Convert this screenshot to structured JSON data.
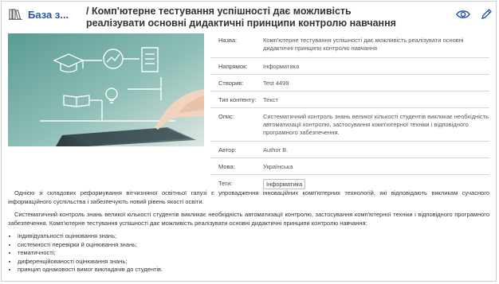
{
  "header": {
    "breadcrumb": "База з...",
    "title": "/ Комп'ютерне тестування успішності дає можливість реалізувати основні дидактичні принципи контролю навчання",
    "icons": {
      "library": "books-icon",
      "view": "eye-icon",
      "edit": "pencil-icon"
    },
    "accent_color": "#2a55a5"
  },
  "info": {
    "rows": [
      {
        "key": "Назва:",
        "value": "Комп'ютерне тестування успішності дає можливість реалізувати основні дидактичні принципи контролю навчання"
      },
      {
        "key": "Напрямок:",
        "value": "Інформатика"
      },
      {
        "key": "Створив:",
        "value": "Test 4499"
      },
      {
        "key": "Тип контенту:",
        "value": "Текст"
      },
      {
        "key": "Опис:",
        "value": "Систематичний контроль знань великої кількості студентів викликає необхідність автоматизації контролю, застосування комп'ютерної техніки і відповідного програмного забезпечення."
      },
      {
        "key": "Автор:",
        "value": "Author B."
      },
      {
        "key": "Мова:",
        "value": "Українська"
      },
      {
        "key": "Теги:",
        "tag": "Інформатика"
      }
    ]
  },
  "description": {
    "paragraphs": [
      "Однією зі складових реформування вітчизняної освітньої галузі є упровадження інноваційних комп'ютерних технологій, які відповідають викликам сучасного інформаційного суспільства і забезпечують новий рівень якості освіти.",
      "Систематичний контроль знань великої кількості студентів викликає необхідність автоматизації контролю, застосування комп'ютерної техніки і відповідного програмного забезпечення. Комп'ютерне тестування успішності дає можливість реалізувати основні дидактичні принципи контролю навчання:"
    ],
    "bullets": [
      "індивідуальності оцінювання знань;",
      "системності перевірки й оцінювання знань;",
      "тематичності;",
      "диференційованості оцінювання знань;",
      "принцип однаковості вимог викладачів до студентів."
    ]
  }
}
